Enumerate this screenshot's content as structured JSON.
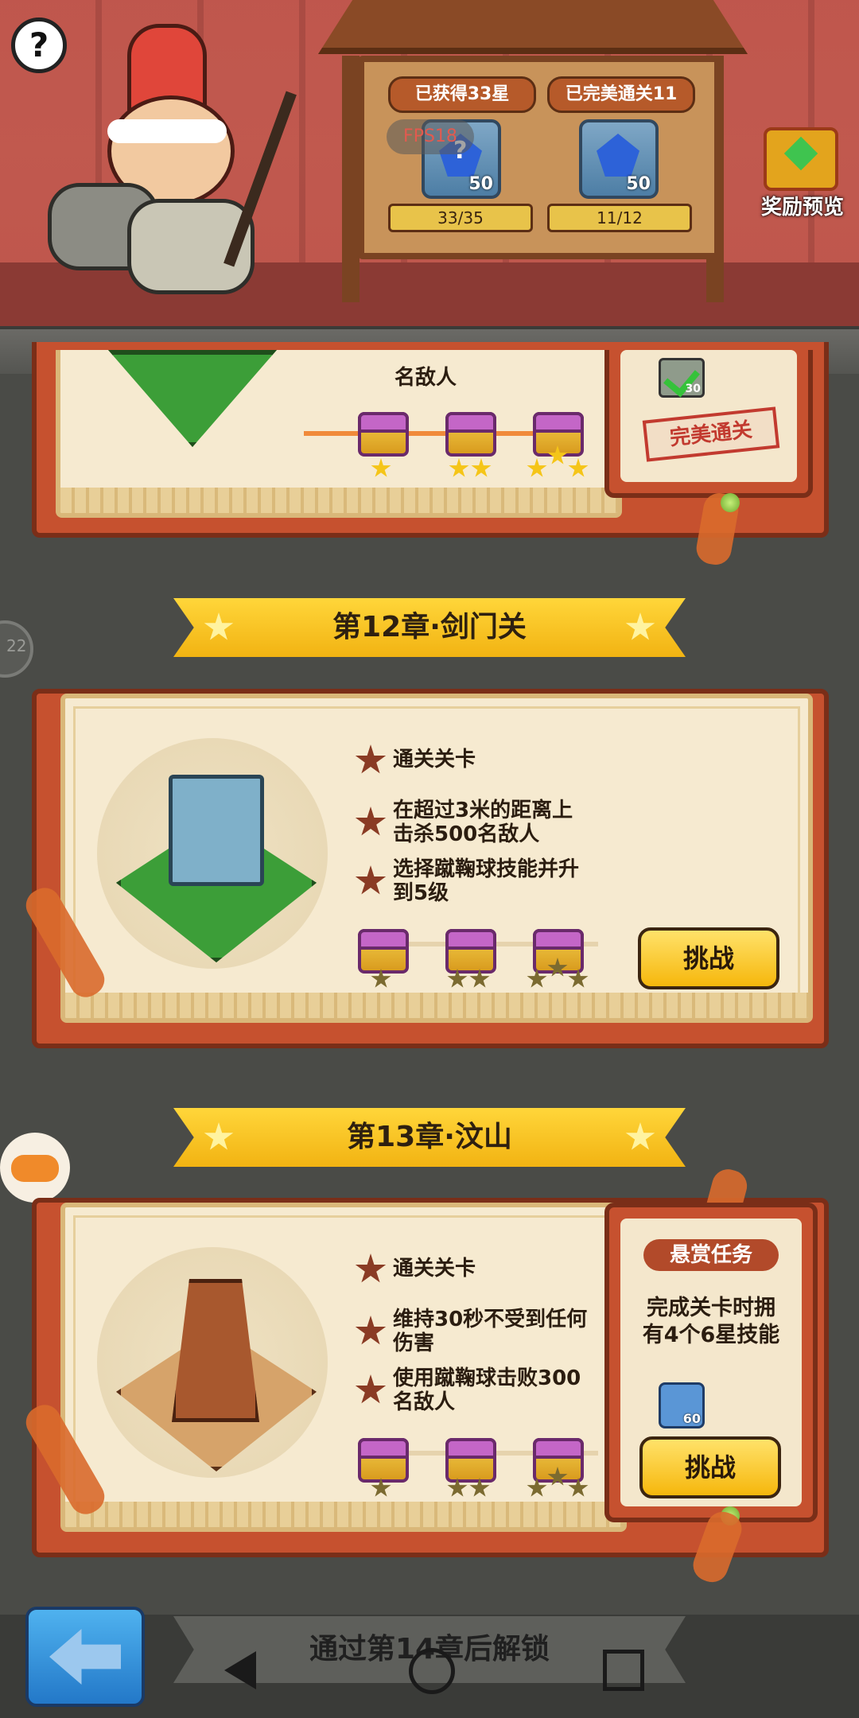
{
  "header": {
    "help_icon": "question-mark-icon",
    "stars_label": "已获得33星",
    "perfect_label": "已完美通关11",
    "fps_label": "FPS18",
    "stars_gem_question": "?",
    "stars_gem_count": "50",
    "perfect_gem_count": "50",
    "stars_progress": "33/35",
    "perfect_progress": "11/12",
    "reward_preview_label": "奖励预览"
  },
  "chapter11_partial": {
    "goal_text": "名敌人",
    "check_count": "30",
    "stamp_text": "完美通关",
    "chest_stars": [
      1,
      2,
      3
    ]
  },
  "chapter12": {
    "title": "第12章·剑门关",
    "goals": [
      "通关关卡",
      "在超过3米的距离上\n击杀500名敌人",
      "选择蹴鞠球技能并升\n到5级"
    ],
    "goal_1": "通关关卡",
    "goal_2_line1": "在超过3米的距离上",
    "goal_2_line2": "击杀500名敌人",
    "goal_3_line1": "选择蹴鞠球技能并升",
    "goal_3_line2": "到5级",
    "challenge_label": "挑战",
    "chest_stars": [
      1,
      2,
      3
    ]
  },
  "chapter13": {
    "title": "第13章·汶山",
    "goal_1": "通关关卡",
    "goal_2_line1": "维持30秒不受到任何",
    "goal_2_line2": "伤害",
    "goal_3_line1": "使用蹴鞠球击败300",
    "goal_3_line2": "名敌人",
    "challenge_label": "挑战",
    "bounty_title": "悬赏任务",
    "bounty_line1": "完成关卡时拥",
    "bounty_line2": "有4个6星技能",
    "bounty_reward_count": "60",
    "chest_stars": [
      1,
      2,
      3
    ]
  },
  "bottom": {
    "lock_text": "通过第14章后解锁",
    "back_icon": "back-arrow-icon"
  },
  "system_nav": {
    "back_icon": "triangle-back-icon",
    "home_icon": "circle-home-icon",
    "recents_icon": "square-recents-icon"
  },
  "side": {
    "gamepad_icon": "gamepad-icon",
    "left_bubble_text": "22"
  }
}
